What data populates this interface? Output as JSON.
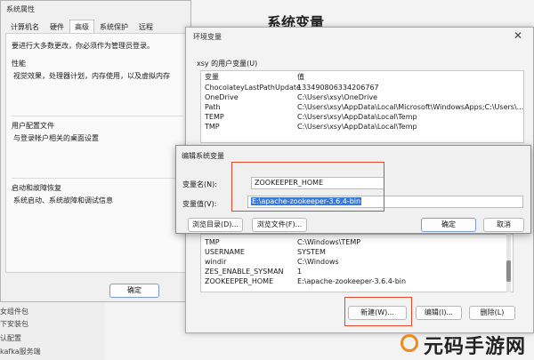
{
  "background": {
    "title": "系统变量",
    "sidebar": [
      "女组件包",
      "下安装包",
      "认配置",
      "kafka服务端"
    ]
  },
  "sysprop": {
    "title": "系统属性",
    "tabs": [
      "计算机名",
      "硬件",
      "高级",
      "系统保护",
      "远程"
    ],
    "active_tab": "高级",
    "admin_note": "要进行大多数更改，你必须作为管理员登录。",
    "performance": {
      "label": "性能",
      "desc": "视觉效果，处理器计划，内存使用，以及虚拟内存"
    },
    "user_profile": {
      "label": "用户配置文件",
      "desc": "与登录帐户相关的桌面设置"
    },
    "startup": {
      "label": "启动和故障恢复",
      "desc": "系统启动、系统故障和调试信息"
    },
    "ok_label": "确定"
  },
  "envvar": {
    "title": "环境变量",
    "close_icon": "close-icon",
    "user_vars_label": "xsy 的用户变量(U)",
    "user_table": {
      "headers": [
        "变量",
        "值"
      ],
      "rows": [
        [
          "ChocolateyLastPathUpdate",
          "133490806334206767"
        ],
        [
          "OneDrive",
          "C:\\Users\\xsy\\OneDrive"
        ],
        [
          "Path",
          "C:\\Users\\xsy\\AppData\\Local\\Microsoft\\WindowsApps;C:\\Users\\..."
        ],
        [
          "TEMP",
          "C:\\Users\\xsy\\AppData\\Local\\Temp"
        ],
        [
          "TMP",
          "C:\\Users\\xsy\\AppData\\Local\\Temp"
        ]
      ]
    },
    "system_table": {
      "rows": [
        [
          "TMP",
          "C:\\Windows\\TEMP"
        ],
        [
          "USERNAME",
          "SYSTEM"
        ],
        [
          "windir",
          "C:\\Windows"
        ],
        [
          "ZES_ENABLE_SYSMAN",
          "1"
        ],
        [
          "ZOOKEEPER_HOME",
          "E:\\apache-zookeeper-3.6.4-bin"
        ]
      ]
    },
    "new_label": "新建(W)...",
    "edit_label": "编辑(I)...",
    "delete_label": "删除(L)"
  },
  "editdlg": {
    "title": "编辑系统变量",
    "name_label": "变量名(N):",
    "name_value": "ZOOKEEPER_HOME",
    "value_label": "变量值(V):",
    "value_value": "E:\\apache-zookeeper-3.6.4-bin",
    "browse_dir_label": "浏览目录(D)...",
    "browse_file_label": "浏览文件(F)...",
    "ok_label": "确定",
    "cancel_label": "取消"
  },
  "watermark": {
    "text": "元码手游网",
    "accent": "#f08a1c"
  },
  "colors": {
    "highlight_box": "#e0492a",
    "selection": "#3a78d8"
  }
}
